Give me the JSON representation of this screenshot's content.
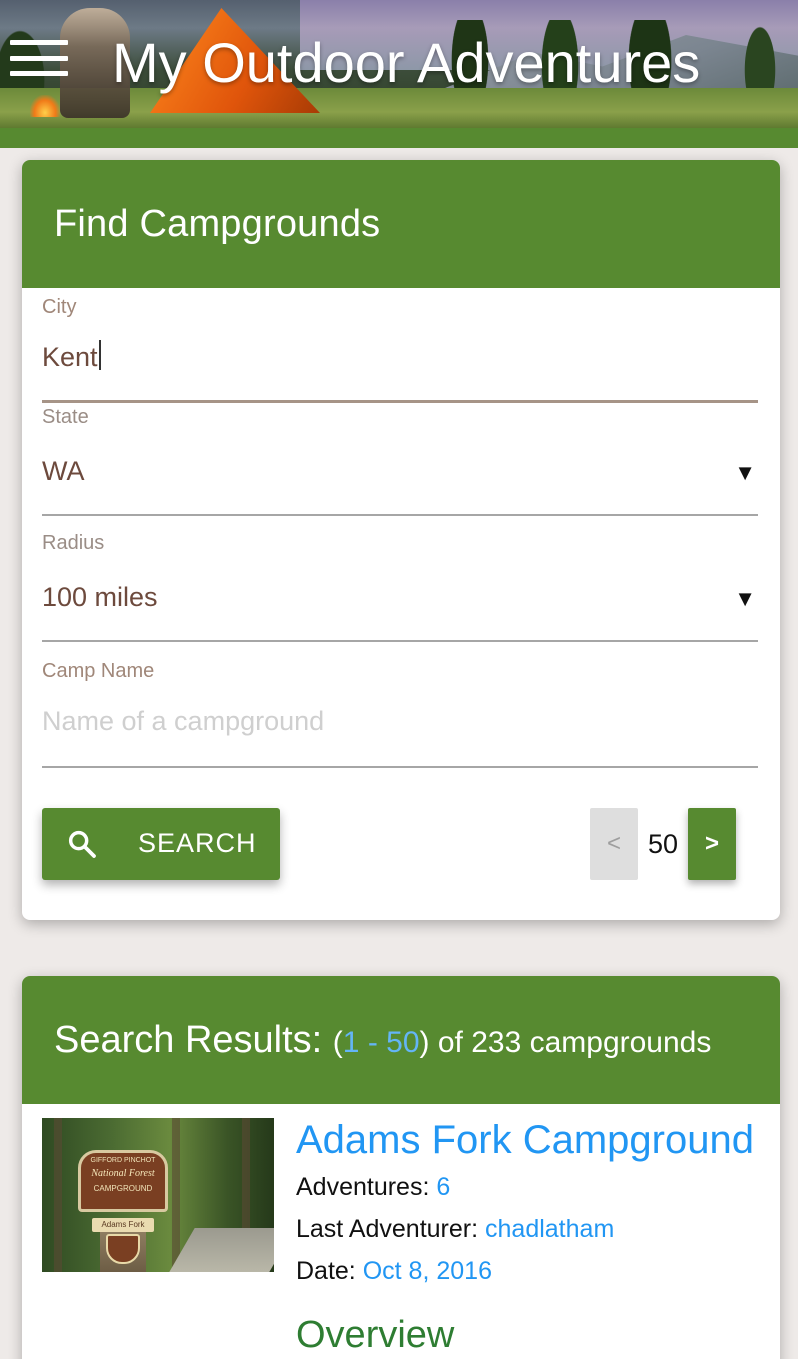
{
  "header": {
    "title": "My Outdoor Adventures",
    "menu_icon": "hamburger-menu-icon"
  },
  "search_form": {
    "title": "Find Campgrounds",
    "city": {
      "label": "City",
      "value": "Kent"
    },
    "state": {
      "label": "State",
      "value": "WA"
    },
    "radius": {
      "label": "Radius",
      "value": "100 miles"
    },
    "camp_name": {
      "label": "Camp Name",
      "placeholder": "Name of a campground"
    },
    "search_button": {
      "label": "SEARCH",
      "icon": "search-icon"
    },
    "pager": {
      "prev": "<",
      "count": "50",
      "next": ">"
    }
  },
  "results": {
    "title": "Search Results:",
    "open_paren": "(",
    "range": "1 - 50",
    "suffix": ") of 233 campgrounds",
    "items": [
      {
        "name": "Adams Fork Campground",
        "thumb_sign_line1": "GIFFORD PINCHOT",
        "thumb_sign_line2": "National Forest",
        "thumb_sign_line3": "CAMPGROUND",
        "thumb_plate": "Adams Fork",
        "adventures_label": "Adventures:",
        "adventures_value": "6",
        "last_adventurer_label": "Last Adventurer:",
        "last_adventurer_value": "chadlatham",
        "date_label": "Date:",
        "date_value": "Oct 8, 2016",
        "overview_label": "Overview"
      }
    ]
  },
  "colors": {
    "primary_green": "#578a30",
    "link_blue": "#2196f3",
    "overview_green": "#2e7d32",
    "input_text": "#6d4a3d"
  }
}
